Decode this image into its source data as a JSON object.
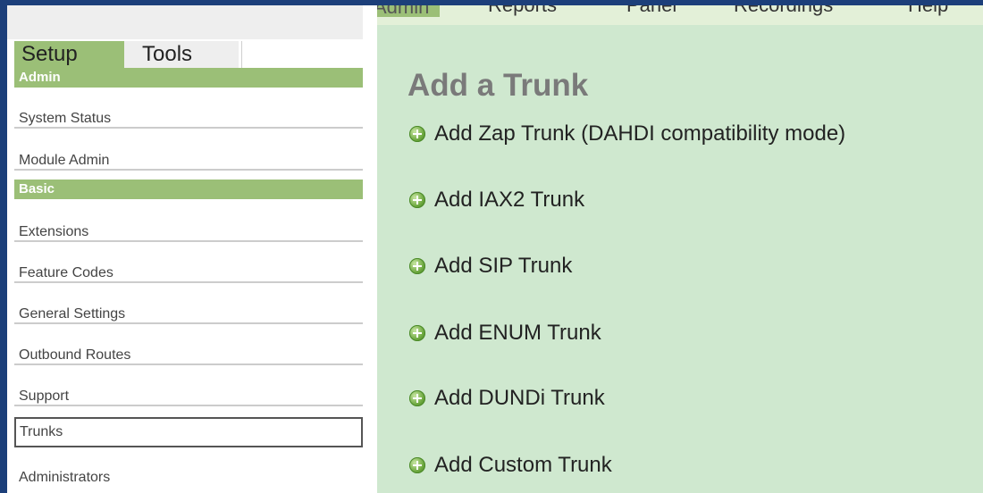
{
  "top_nav": {
    "tabs": [
      "Admin",
      "Reports",
      "Panel",
      "Recordings",
      "Help"
    ]
  },
  "sidebar": {
    "tabs": [
      "Setup",
      "Tools"
    ],
    "sections": [
      {
        "label": "Admin",
        "items": [
          "System Status",
          "Module Admin"
        ]
      },
      {
        "label": "Basic",
        "items": [
          "Extensions",
          "Feature Codes",
          "General Settings",
          "Outbound Routes",
          "Support",
          "Trunks",
          "Administrators"
        ]
      }
    ],
    "selected_item": "Trunks"
  },
  "main": {
    "title": "Add a Trunk",
    "links": [
      "Add Zap Trunk (DAHDI compatibility mode)",
      "Add IAX2 Trunk",
      "Add SIP Trunk",
      "Add ENUM Trunk",
      "Add DUNDi Trunk",
      "Add Custom Trunk"
    ],
    "link_icon": "plus-circle-icon"
  },
  "colors": {
    "accent_green": "#9bbf77",
    "content_bg": "#cfe8cf",
    "frame_blue": "#1c3f7a"
  }
}
